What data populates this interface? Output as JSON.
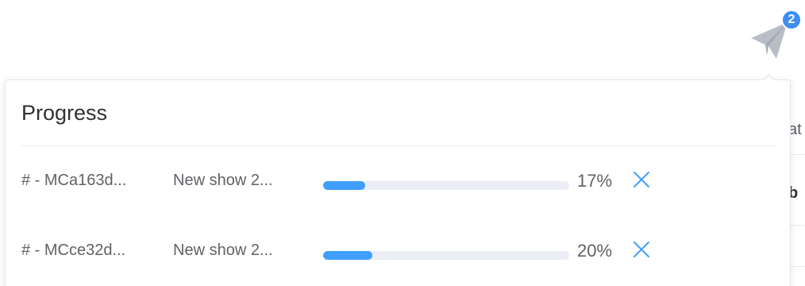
{
  "notification": {
    "icon": "paper-plane-icon",
    "badge_count": "2",
    "badge_color": "#3d8ef5",
    "icon_color": "#b9bec6"
  },
  "progress_panel": {
    "title": "Progress",
    "accent_color": "#409eff",
    "items": [
      {
        "id": "# - MCa163d...",
        "name": "New show 2...",
        "progress": 0.17,
        "percent_label": "17%",
        "close_icon": "close-icon"
      },
      {
        "id": "# - MCce32d...",
        "name": "New show 2...",
        "progress": 0.2,
        "percent_label": "20%",
        "close_icon": "close-icon"
      }
    ]
  },
  "background": {
    "partial_text_1": "at",
    "partial_text_2": "b"
  }
}
